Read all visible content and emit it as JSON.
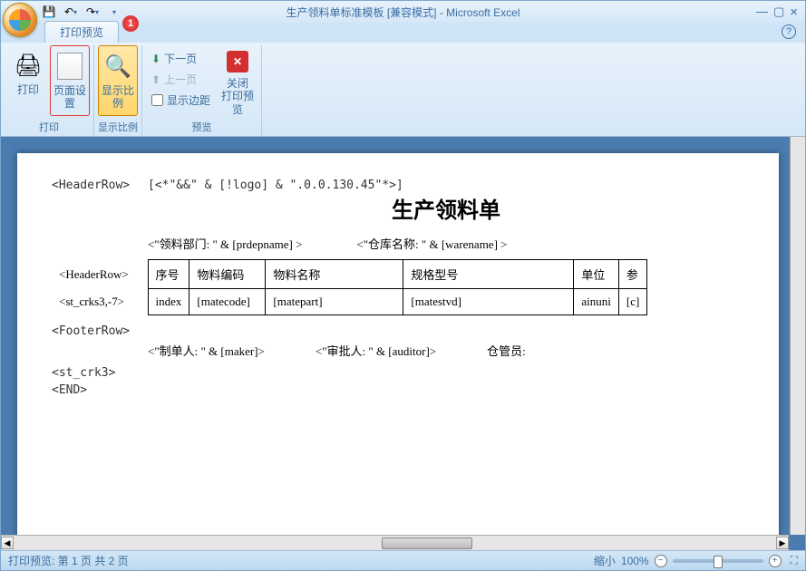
{
  "window": {
    "title": "生产领料单标准模板  [兼容模式] - Microsoft Excel"
  },
  "qat": {
    "save": "save",
    "undo": "undo",
    "redo": "redo"
  },
  "tabs": {
    "active": "打印预览",
    "badge": "1"
  },
  "help": "?",
  "ribbon": {
    "print_group": {
      "print": "打印",
      "page_setup": "页面设置",
      "label": "打印"
    },
    "zoom_group": {
      "zoom": "显示比例",
      "label": "显示比例"
    },
    "preview_group": {
      "next_page": "下一页",
      "prev_page": "上一页",
      "show_margins": "显示边距",
      "close": "关闭",
      "close2": "打印预览",
      "label": "预览"
    }
  },
  "document": {
    "header_row_tag": "<HeaderRow>",
    "header_expr": "[<*\"&&\" & [!logo] & \".0.0.130.45\"*>]",
    "title": "生产领料单",
    "dept_field": "<\"领料部门: \" & [prdepname] >",
    "warehouse_field": "<\"仓库名称: \" & [warename] >",
    "table": {
      "headers": {
        "seq": "序号",
        "code": "物料编码",
        "name": "物料名称",
        "spec": "规格型号",
        "unit": "单位",
        "last": "参"
      },
      "row": {
        "seq": "index",
        "code": "[matecode]",
        "name": "[matepart]",
        "spec": "[matestvd]",
        "unit": "ainuni",
        "last": "[c]"
      }
    },
    "detail_tag": "<st_crks3,-7>",
    "footer_row_tag": "<FooterRow>",
    "maker_field": "<\"制单人: \" & [maker]>",
    "auditor_field": "<\"审批人: \" & [auditor]>",
    "keeper_field": "仓管员:",
    "st_crk3_tag": "<st_crk3>",
    "end_tag": "<END>"
  },
  "statusbar": {
    "text": "打印预览: 第 1 页  共 2 页",
    "zoom_label": "缩小",
    "zoom_pct": "100%"
  }
}
